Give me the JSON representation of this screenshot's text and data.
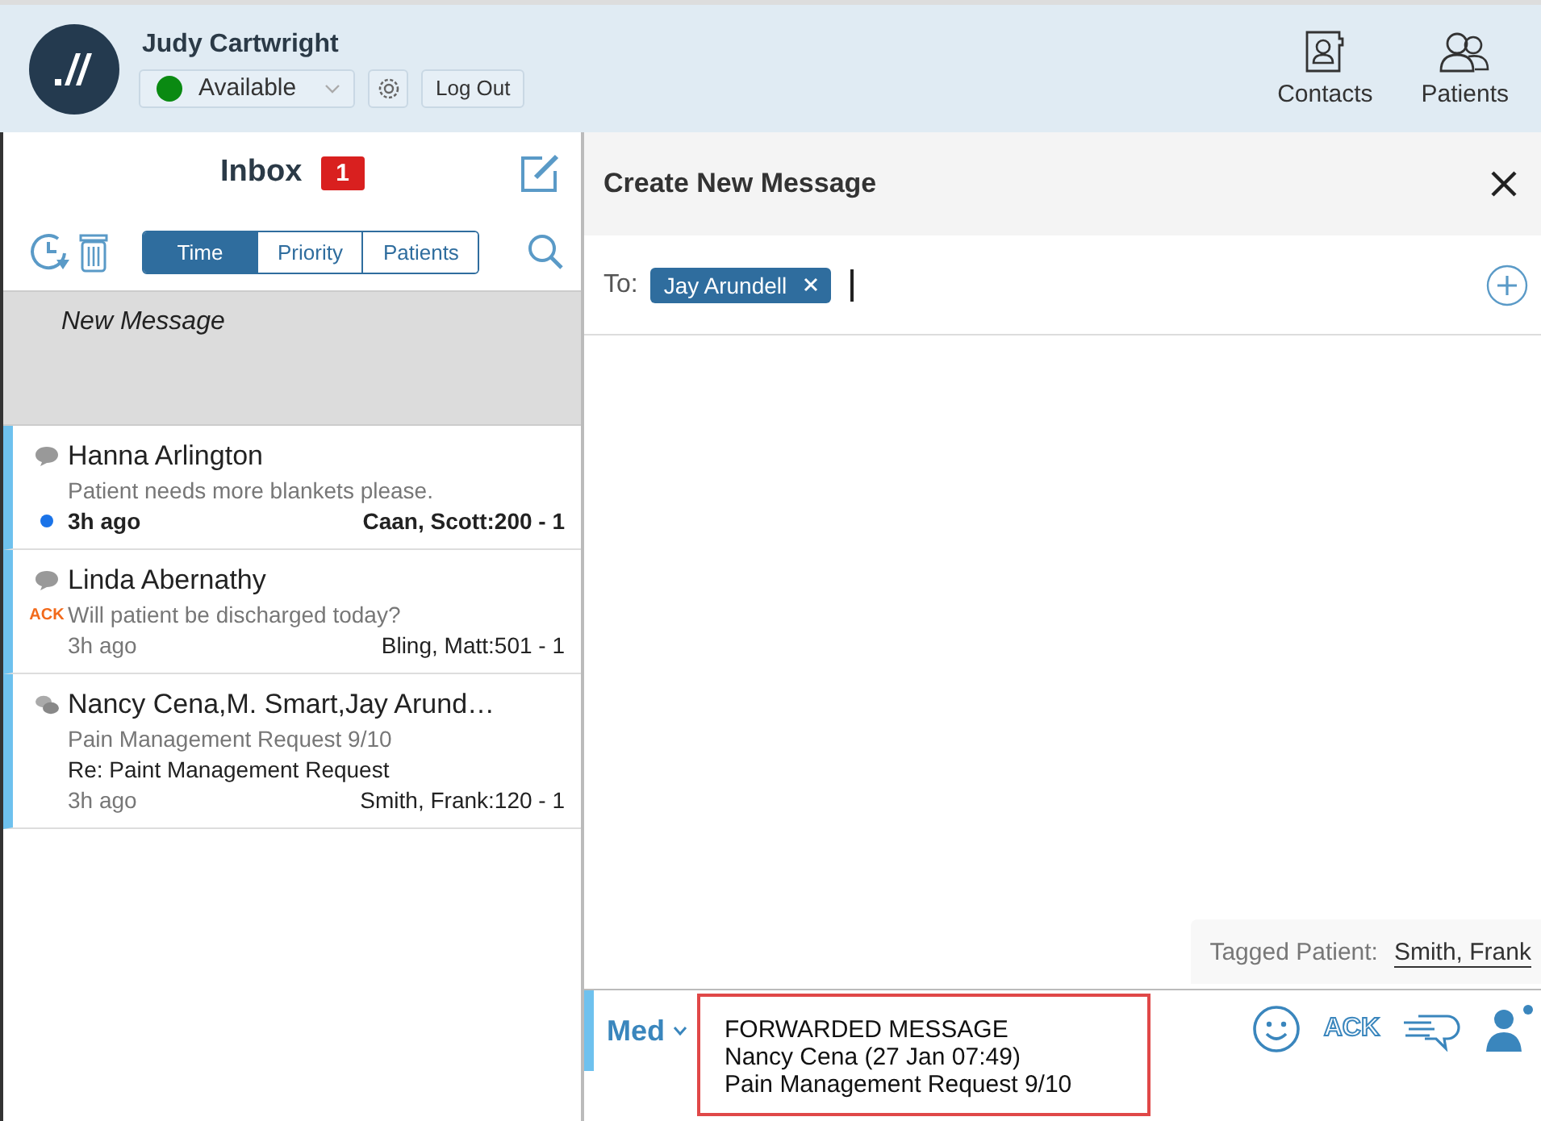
{
  "user": {
    "name": "Judy Cartwright",
    "status": {
      "label": "Available",
      "color": "#0a8a12"
    },
    "logout": "Log Out"
  },
  "nav": [
    {
      "kind": "contacts",
      "label": "Contacts"
    },
    {
      "kind": "patients",
      "label": "Patients"
    }
  ],
  "inbox": {
    "title": "Inbox",
    "unread_count": "1",
    "tabs": [
      {
        "label": "Time",
        "selected": true
      },
      {
        "label": "Priority",
        "selected": false
      },
      {
        "label": "Patients",
        "selected": false
      }
    ],
    "draft": {
      "label": "New Message",
      "selected": true
    },
    "messages": [
      {
        "kind": "single",
        "sender": "Hanna Arlington",
        "preview": "Patient needs more blankets please.",
        "time": "3h ago",
        "patient": "Caan, Scott:200 - 1",
        "unread": true
      },
      {
        "kind": "single",
        "sender": "Linda Abernathy",
        "ack": "ACK",
        "preview": "Will patient be discharged today?",
        "time": "3h ago",
        "patient": "Bling, Matt:501 - 1",
        "unread": false
      },
      {
        "kind": "group",
        "sender": "Nancy Cena,M. Smart,Jay Arund…",
        "preview": "Pain Management Request 9/10",
        "subject": "Re: Paint Management Request",
        "time": "3h ago",
        "patient": "Smith, Frank:120 - 1",
        "unread": false
      }
    ]
  },
  "compose": {
    "title": "Create New Message",
    "to_label": "To:",
    "recipients": [
      "Jay Arundell"
    ],
    "tagged_label": "Tagged Patient:",
    "tagged_patient": "Smith, Frank",
    "priority": "Med",
    "message_lines": [
      "FORWARDED MESSAGE",
      "Nancy Cena (27 Jan 07:49)",
      "Pain Management Request 9/10"
    ],
    "ack_label": "ACK"
  }
}
